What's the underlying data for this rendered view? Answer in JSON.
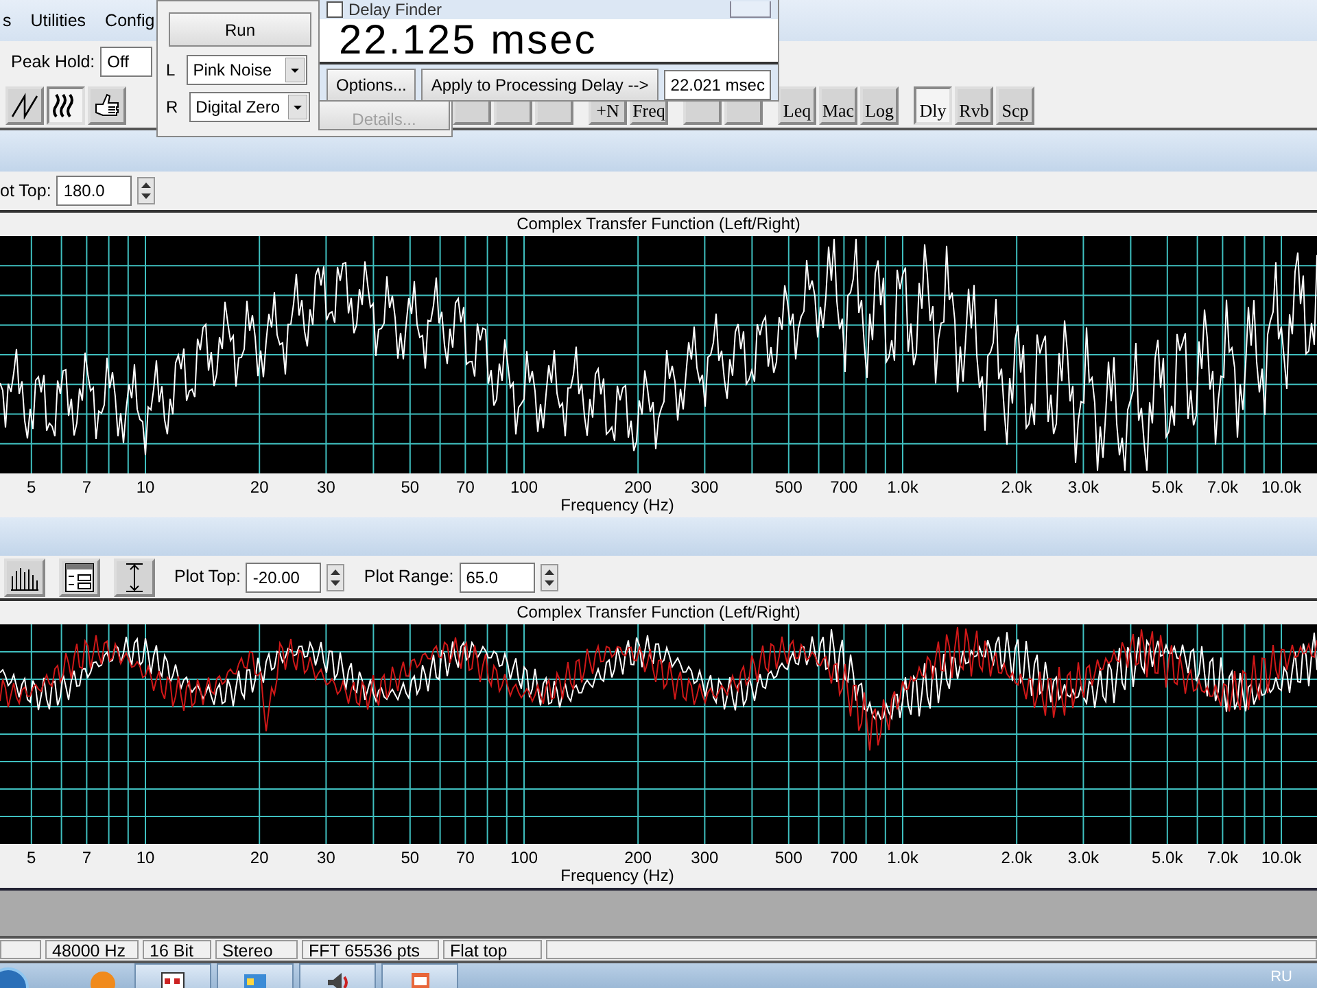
{
  "menu_bar": {
    "items": [
      "s",
      "Utilities",
      "Config"
    ]
  },
  "peak_hold": {
    "label": "Peak Hold:",
    "value": "Off"
  },
  "toolbar": {
    "buttons": [
      {
        "kind": "sawtooth",
        "selected": false
      },
      {
        "kind": "waves",
        "selected": true
      },
      {
        "kind": "hand",
        "selected": false
      },
      {
        "kind": "blank",
        "selected": false
      },
      {
        "kind": "blank",
        "selected": false
      },
      {
        "kind": "blank",
        "selected": false
      },
      {
        "kind": "text",
        "label": "+N",
        "selected": false
      },
      {
        "kind": "text",
        "label": "Freq",
        "selected": false
      },
      {
        "kind": "blank",
        "selected": false
      },
      {
        "kind": "blank",
        "selected": false
      },
      {
        "kind": "text",
        "label": "Leq",
        "selected": false
      },
      {
        "kind": "text",
        "label": "Mac",
        "selected": false
      },
      {
        "kind": "text",
        "label": "Log",
        "selected": false
      },
      {
        "kind": "text",
        "label": "Dly",
        "selected": true
      },
      {
        "kind": "text",
        "label": "Rvb",
        "selected": false
      },
      {
        "kind": "text",
        "label": "Scp",
        "selected": false
      }
    ]
  },
  "generator": {
    "run_button": "Run",
    "channels": [
      {
        "label": "L",
        "value": "Pink Noise"
      },
      {
        "label": "R",
        "value": "Digital Zero"
      }
    ],
    "details_button": {
      "label": "Details...",
      "disabled": true
    }
  },
  "delay_finder": {
    "title": "Delay Finder",
    "checked": false,
    "reading": "22.125 msec",
    "options_button": "Options...",
    "apply_button": "Apply to Processing Delay -->",
    "value": "22.021 msec"
  },
  "plots": [
    {
      "controls": [
        {
          "label": "ot Top:",
          "value": "180.0"
        }
      ],
      "title": "Complex Transfer Function (Left/Right)",
      "xlabel": "Frequency (Hz)",
      "x_tick_labels": [
        "5",
        "7",
        "10",
        "20",
        "30",
        "50",
        "70",
        "100",
        "200",
        "300",
        "500",
        "700",
        "1.0k",
        "2.0k",
        "3.0k",
        "5.0k",
        "7.0k",
        "10.0k"
      ],
      "traces": [
        {
          "color": "#ffffff"
        }
      ]
    },
    {
      "tools": [
        {
          "kind": "bars"
        },
        {
          "kind": "panel"
        },
        {
          "kind": "range"
        }
      ],
      "controls": [
        {
          "label": "Plot Top:",
          "value": "-20.00"
        },
        {
          "label": "Plot Range:",
          "value": "65.0"
        }
      ],
      "title": "Complex Transfer Function (Left/Right)",
      "xlabel": "Frequency (Hz)",
      "x_tick_labels": [
        "5",
        "7",
        "10",
        "20",
        "30",
        "50",
        "70",
        "100",
        "200",
        "300",
        "500",
        "700",
        "1.0k",
        "2.0k",
        "3.0k",
        "5.0k",
        "7.0k",
        "10.0k"
      ],
      "traces": [
        {
          "color": "#ffffff"
        },
        {
          "color": "#d01818"
        }
      ]
    }
  ],
  "status_bar": {
    "fields": [
      "48000 Hz",
      "16 Bit",
      "Stereo",
      "FFT 65536 pts",
      "Flat top"
    ]
  },
  "taskbar": {
    "language": "RU"
  }
}
